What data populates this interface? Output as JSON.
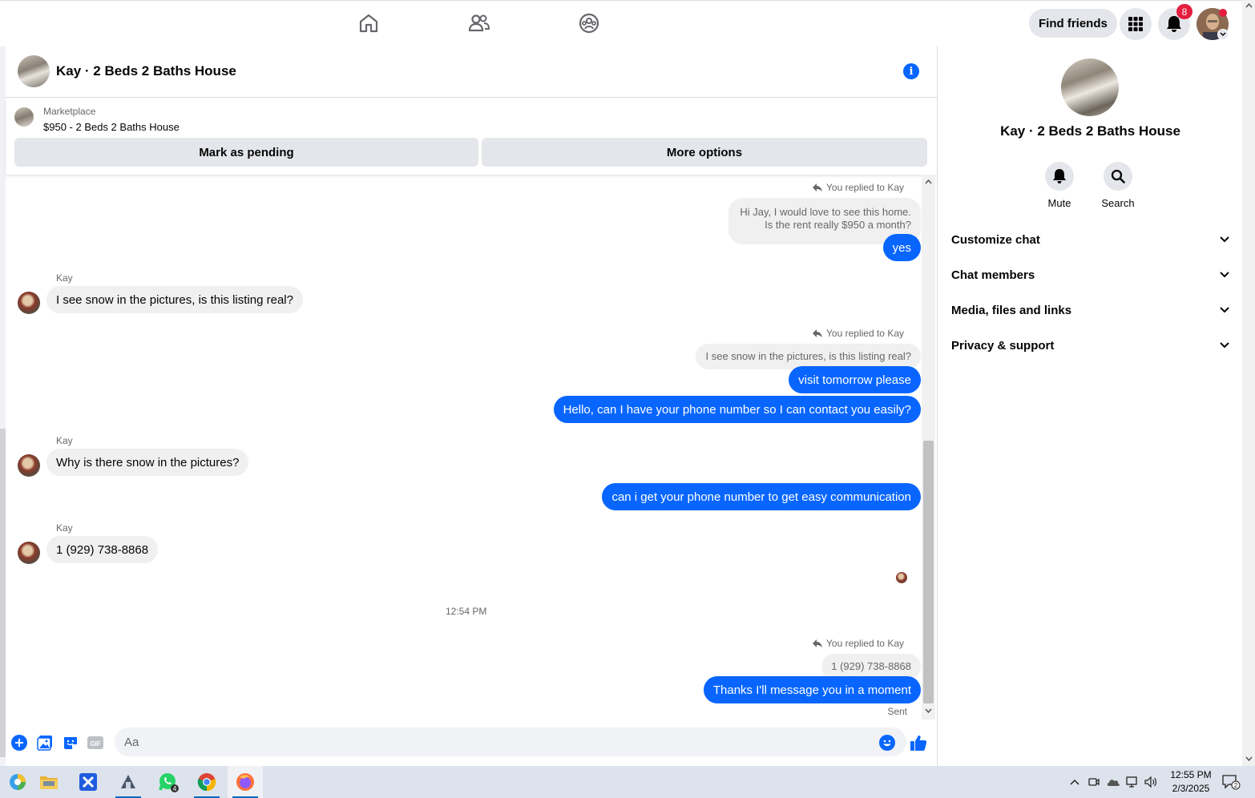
{
  "topbar": {
    "find_friends": "Find friends",
    "notification_count": "8"
  },
  "chat": {
    "title": "Kay · 2 Beds 2 Baths House",
    "marketplace_label": "Marketplace",
    "listing": "$950 - 2 Beds 2 Baths House",
    "mark_pending": "Mark as pending",
    "more_options": "More options"
  },
  "messages": {
    "reply_tag": "You replied to Kay",
    "q1": "Hi Jay, I would love to see this home.",
    "q1b": "Is the rent really $950 a month?",
    "m1": "yes",
    "sender": "Kay",
    "in1": "I see snow in the pictures, is this listing real?",
    "q2": "I see snow in the pictures, is this listing real?",
    "m2": "visit tomorrow please",
    "m3": "Hello, can I have your phone number so I can contact you easily?",
    "in2": "Why is there snow in the pictures?",
    "m4": "can i get your phone number to get easy communication",
    "in3": "1 (929) 738-8868",
    "timestamp": "12:54 PM",
    "q3": "1 (929) 738-8868",
    "m5": "Thanks I'll message you in a moment",
    "sent": "Sent"
  },
  "composer": {
    "placeholder": "Aa",
    "gif": "GIF"
  },
  "right_panel": {
    "title": "Kay · 2 Beds 2 Baths House",
    "mute": "Mute",
    "search": "Search",
    "rows": [
      "Customize chat",
      "Chat members",
      "Media, files and links",
      "Privacy & support"
    ]
  },
  "taskbar": {
    "time": "12:55 PM",
    "date": "2/3/2025",
    "whatsapp_badge": "4",
    "notif_count": "2"
  },
  "colors": {
    "accent": "#0866ff",
    "bubble_in": "#f0f0f0",
    "badge": "#e41e3f"
  }
}
